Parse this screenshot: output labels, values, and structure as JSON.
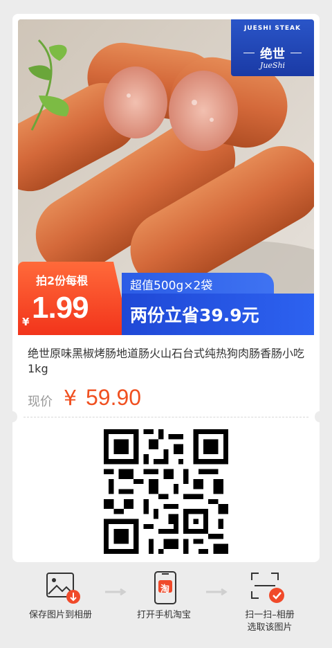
{
  "brand": {
    "en": "JUESHI STEAK",
    "cn": "绝世",
    "script": "JueShi"
  },
  "promo": {
    "tag": "拍2份每根",
    "currency": "¥",
    "price": "1.99",
    "subtitle": "超值500g×2袋",
    "headline": "两份立省39.9元"
  },
  "product": {
    "title": "绝世原味黑椒烤肠地道肠火山石台式纯热狗肉肠香肠小吃 1kg",
    "price_label": "现价",
    "currency": "¥",
    "price": "59.90"
  },
  "colors": {
    "accent_red": "#f2341b",
    "accent_blue": "#1f48d6",
    "price_orange": "#f05020"
  },
  "steps": [
    {
      "icon": "save-image-icon",
      "label": "保存图片到相册"
    },
    {
      "icon": "taobao-phone-icon",
      "taobao_char": "淘",
      "label": "打开手机淘宝"
    },
    {
      "icon": "scan-icon",
      "label": "扫一扫–相册",
      "label2": "选取该图片"
    }
  ]
}
